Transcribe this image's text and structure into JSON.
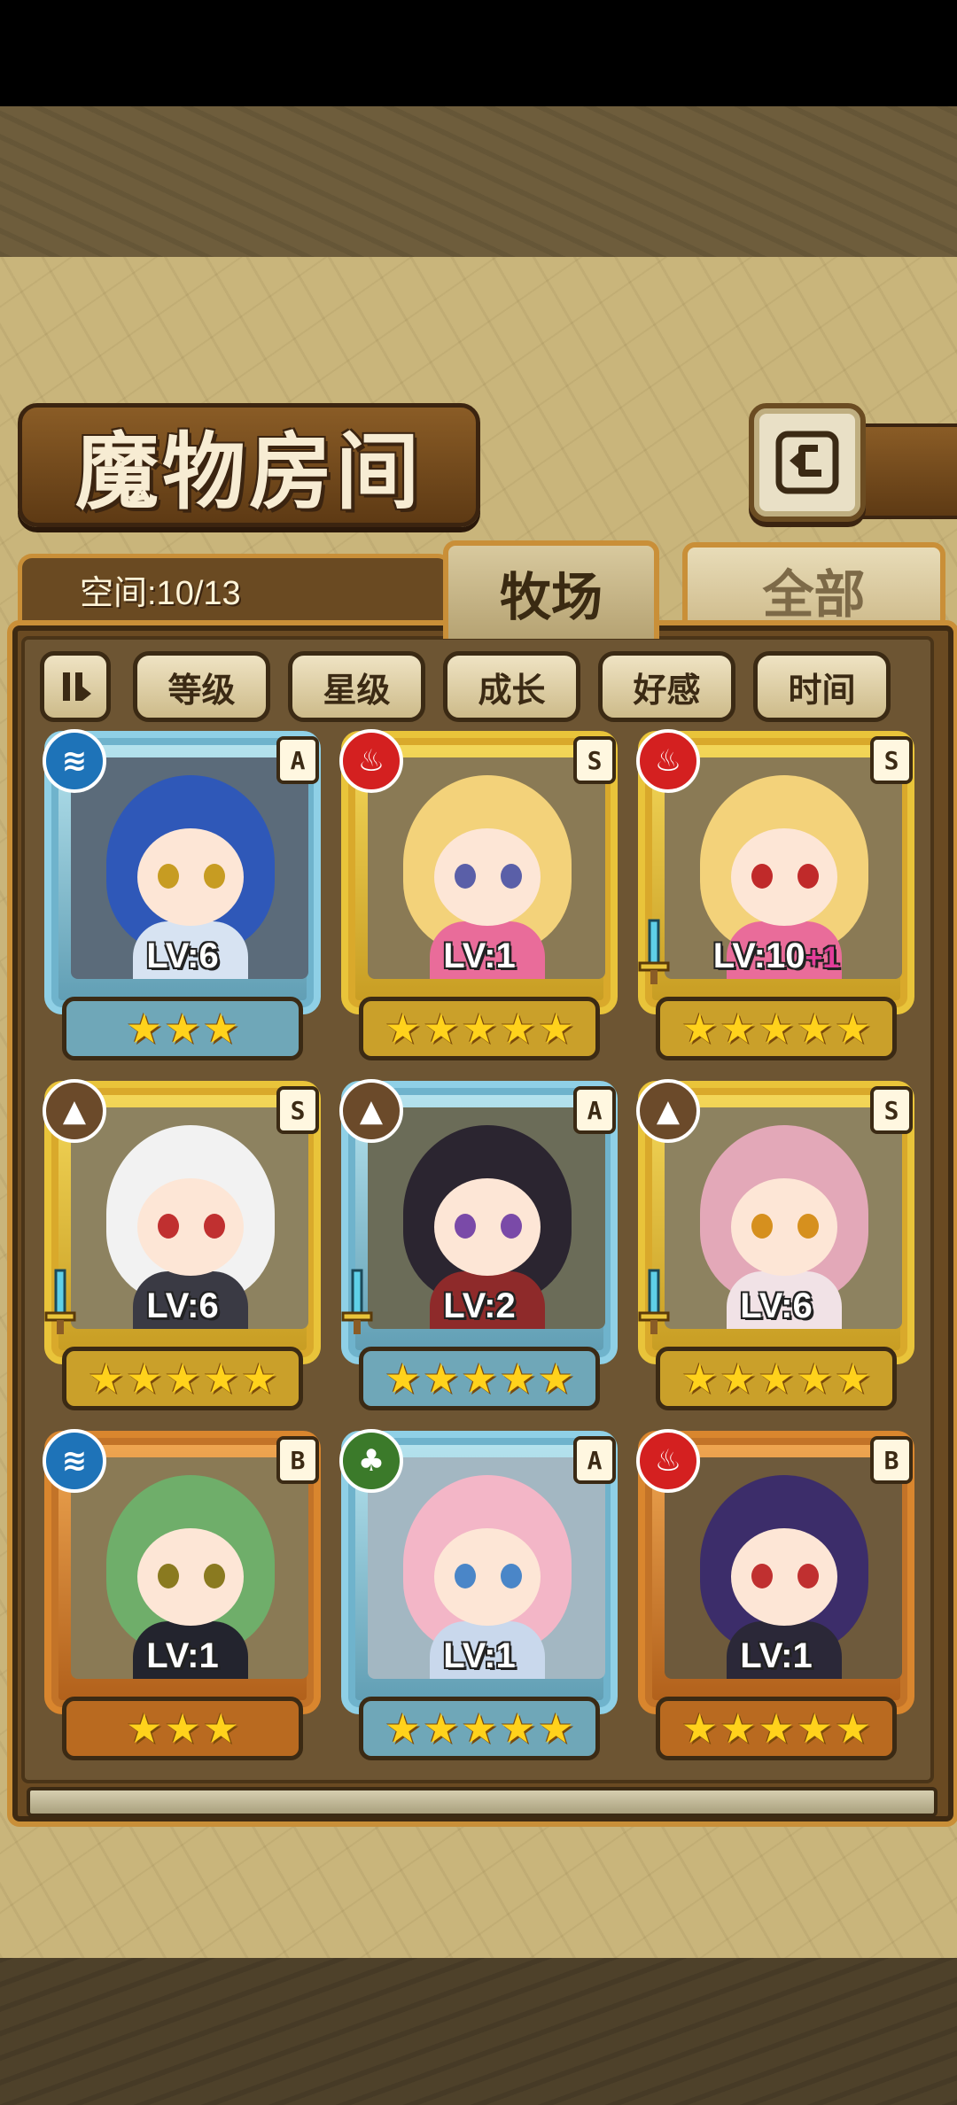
{
  "title": "魔物房间",
  "capacity": "空间:10/13",
  "tabs": {
    "ranch": "牧场",
    "all": "全部"
  },
  "filters": [
    "等级",
    "星级",
    "成长",
    "好感",
    "时间"
  ],
  "colors": {
    "fire": "#d42020",
    "water": "#1e73b8",
    "earth": "#6b4a2a",
    "grass": "#3b7a2a"
  },
  "monsters": [
    {
      "element": "water",
      "element_icon": "waves-icon",
      "rank": "A",
      "level": "LV:6",
      "bonus": "",
      "stars": 3,
      "sword": false
    },
    {
      "element": "fire",
      "element_icon": "flame-icon",
      "rank": "S",
      "level": "LV:1",
      "bonus": "",
      "stars": 5,
      "sword": false
    },
    {
      "element": "fire",
      "element_icon": "flame-icon",
      "rank": "S",
      "level": "LV:10",
      "bonus": "+1",
      "stars": 5,
      "sword": true
    },
    {
      "element": "earth",
      "element_icon": "mountain-icon",
      "rank": "S",
      "level": "LV:6",
      "bonus": "",
      "stars": 5,
      "sword": true
    },
    {
      "element": "earth",
      "element_icon": "mountain-icon",
      "rank": "A",
      "level": "LV:2",
      "bonus": "",
      "stars": 5,
      "sword": true
    },
    {
      "element": "earth",
      "element_icon": "mountain-icon",
      "rank": "S",
      "level": "LV:6",
      "bonus": "",
      "stars": 5,
      "sword": true
    },
    {
      "element": "water",
      "element_icon": "waves-icon",
      "rank": "B",
      "level": "LV:1",
      "bonus": "",
      "stars": 3,
      "sword": false
    },
    {
      "element": "grass",
      "element_icon": "leaf-icon",
      "rank": "A",
      "level": "LV:1",
      "bonus": "",
      "stars": 5,
      "sword": false
    },
    {
      "element": "fire",
      "element_icon": "flame-icon",
      "rank": "B",
      "level": "LV:1",
      "bonus": "",
      "stars": 5,
      "sword": false
    }
  ]
}
